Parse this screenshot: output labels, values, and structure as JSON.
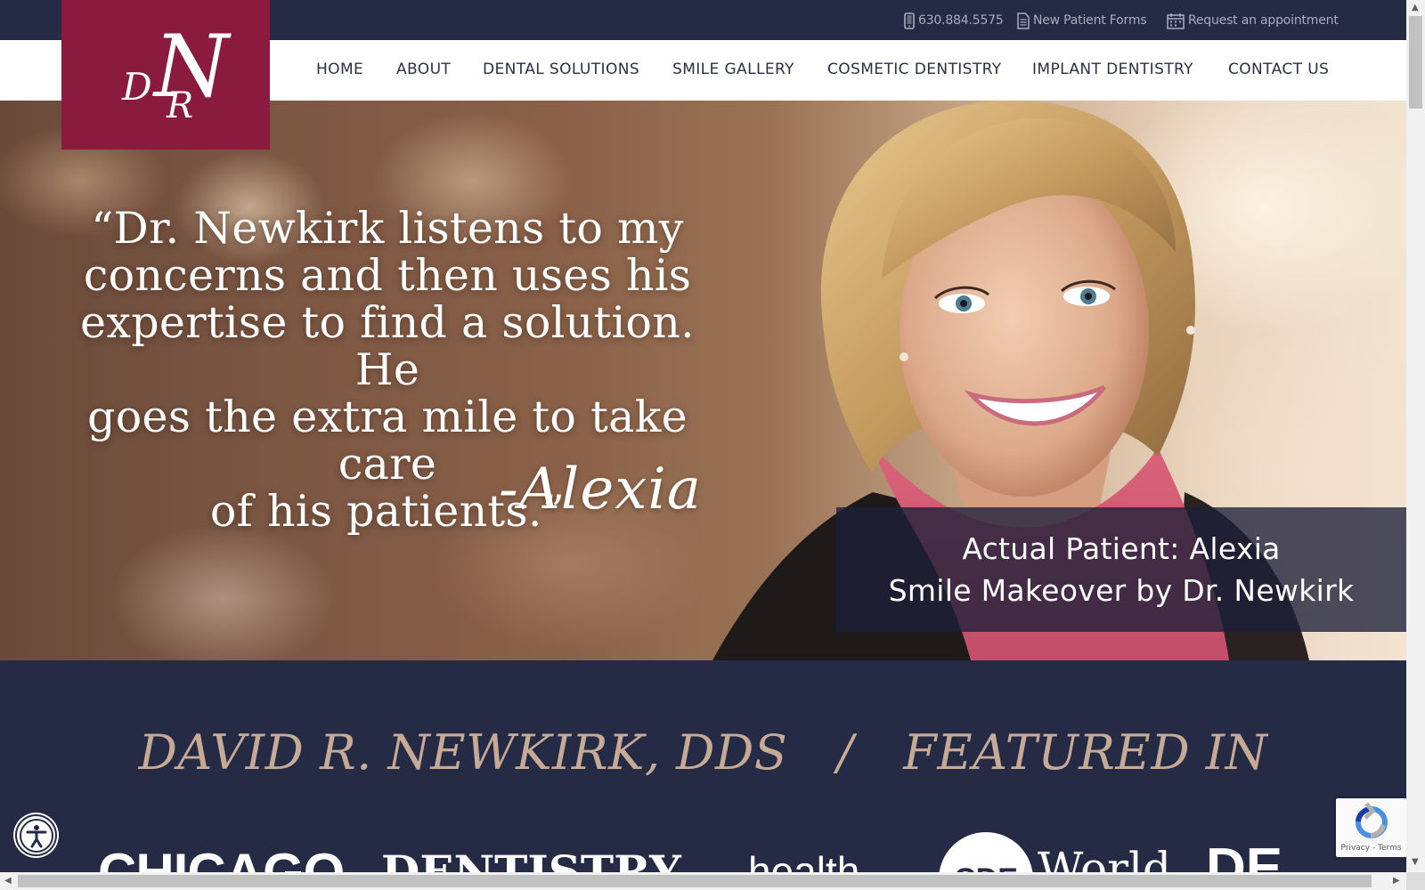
{
  "utility_bar": {
    "phone": "630.884.5575",
    "forms": "New Patient Forms",
    "appointment": "Request an appointment"
  },
  "logo": {
    "text": "DNR",
    "brand_color": "#8a1a3e"
  },
  "nav": {
    "items": [
      {
        "label": "HOME"
      },
      {
        "label": "ABOUT"
      },
      {
        "label": "DENTAL SOLUTIONS"
      },
      {
        "label": "SMILE GALLERY"
      },
      {
        "label": "COSMETIC DENTISTRY"
      },
      {
        "label": "IMPLANT DENTISTRY"
      },
      {
        "label": "CONTACT US"
      }
    ]
  },
  "hero": {
    "quote_lines": [
      "“Dr. Newkirk listens to my",
      "concerns and then uses his",
      "expertise to find a solution. He",
      "goes the extra mile to take care",
      "of his patients.”"
    ],
    "signature": "-Alexia",
    "caption_line1": "Actual Patient: Alexia",
    "caption_line2": "Smile Makeover by Dr. Newkirk"
  },
  "featured": {
    "name": "DAVID R. NEWKIRK, DDS",
    "separator": "/",
    "label": "FEATURED IN",
    "logos": [
      "CHICAGO",
      "DENTISTRY",
      "health",
      "CDE",
      "World",
      "DE"
    ]
  },
  "accessibility": {
    "icon": "accessibility-icon"
  },
  "recaptcha": {
    "links": "Privacy - Terms"
  },
  "colors": {
    "navy": "#252a45",
    "gold": "#c7aa96",
    "burgundy": "#8a1a3e"
  }
}
